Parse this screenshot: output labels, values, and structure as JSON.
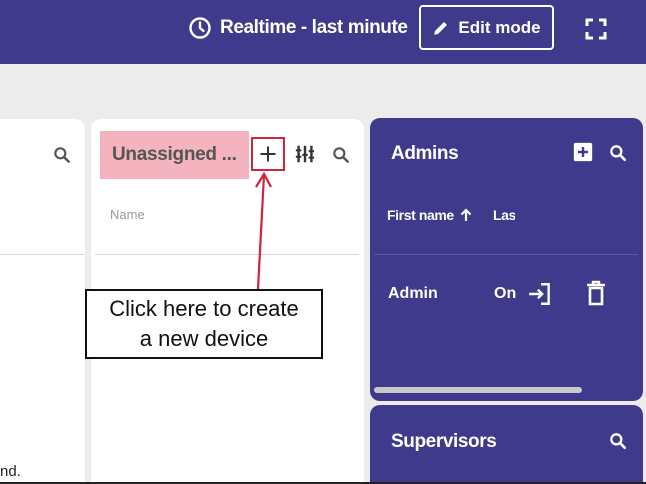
{
  "header": {
    "realtime_label": "Realtime - last minute",
    "edit_mode_label": "Edit mode",
    "icons": [
      "clock-icon",
      "pencil-icon",
      "fullscreen-icon"
    ]
  },
  "left_panel": {
    "truncated_text": "nd."
  },
  "unassigned_panel": {
    "title": "Unassigned ...",
    "column_name": "Name",
    "icons": [
      "add-icon",
      "column-settings-icon",
      "search-icon"
    ]
  },
  "callout": {
    "text": "Click here to create\na new device"
  },
  "admins_panel": {
    "title": "Admins",
    "columns": [
      "First name",
      "Las"
    ],
    "rows": [
      {
        "first_name": "Admin",
        "last_name_truncated": "On"
      }
    ],
    "icons": [
      "add-box-icon",
      "search-icon",
      "login-icon",
      "trash-icon",
      "sort-arrow-up-icon"
    ]
  },
  "supervisors_panel": {
    "title": "Supervisors"
  },
  "colors": {
    "brand": "#3f3a8c",
    "highlight": "#f4b4bf",
    "annotation": "#d0243a"
  }
}
